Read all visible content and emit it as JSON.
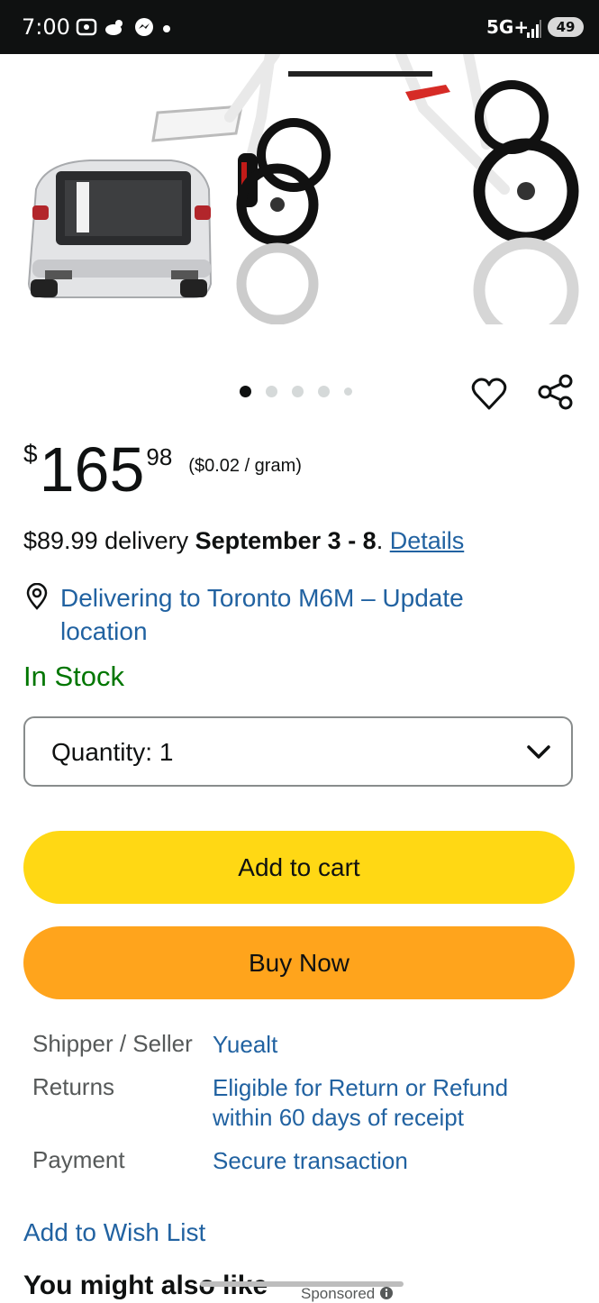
{
  "status_bar": {
    "time": "7:00",
    "network": "5G+",
    "battery": "49"
  },
  "carousel": {
    "dot_count": 5,
    "active_index": 0
  },
  "price": {
    "currency_symbol": "$",
    "whole": "165",
    "fraction": "98",
    "unit_price": "($0.02 / gram)"
  },
  "delivery": {
    "prefix": "$89.99 delivery ",
    "date": "September 3 - 8",
    "separator": ". ",
    "details_link": "Details"
  },
  "location": {
    "text": "Delivering to Toronto M6M – Update location"
  },
  "stock_status": "In Stock",
  "quantity": {
    "label": "Quantity:",
    "value": "1"
  },
  "buttons": {
    "add_to_cart": "Add to cart",
    "buy_now": "Buy Now"
  },
  "details": [
    {
      "key": "Shipper / Seller",
      "value": "Yuealt"
    },
    {
      "key": "Returns",
      "value": "Eligible for Return or Refund within 60 days of receipt"
    },
    {
      "key": "Payment",
      "value": "Secure transaction"
    }
  ],
  "wish_list": "Add to Wish List",
  "recommendations": {
    "title": "You might also like",
    "sponsored": "Sponsored"
  },
  "colors": {
    "link": "#2162a1",
    "in_stock": "#007600",
    "add_to_cart_bg": "#ffd814",
    "buy_now_bg": "#ffa41c"
  }
}
